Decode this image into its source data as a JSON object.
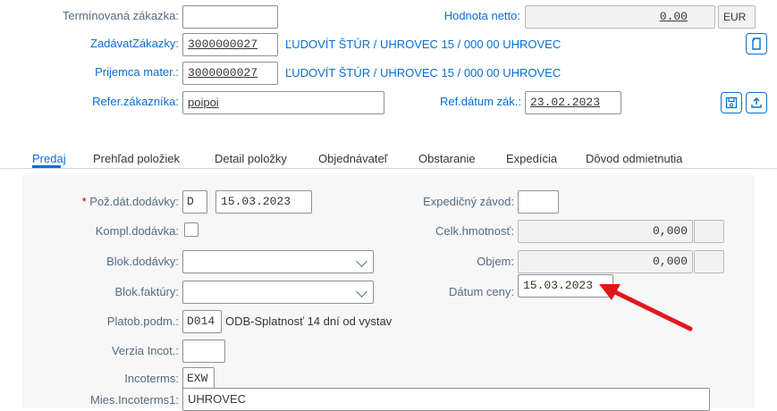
{
  "header": {
    "terminovana_label": "Termínovaná zákazka:",
    "terminovana_value": "",
    "hodnota_label": "Hodnota netto:",
    "hodnota_value": "0.00",
    "hodnota_currency": "EUR",
    "zadavat_label": "ZadávatZákazky:",
    "zadavat_value": "3000000027",
    "zadavat_desc": "ĽUDOVÍT ŠTÚR / UHROVEC 15 / 000 00 UHROVEC",
    "prijemca_label": "Prijemca mater.:",
    "prijemca_value": "3000000027",
    "prijemca_desc": "ĽUDOVÍT ŠTÚR / UHROVEC 15 / 000 00 UHROVEC",
    "refer_label": "Refer.zákazníka:",
    "refer_value": "poipoi",
    "refdatum_label": "Ref.dátum zák.:",
    "refdatum_value": "23.02.2023"
  },
  "tabs": [
    {
      "label": "Predaj",
      "active": true
    },
    {
      "label": "Prehľad položiek"
    },
    {
      "label": "Detail položky"
    },
    {
      "label": "Objednávateľ"
    },
    {
      "label": "Obstaranie"
    },
    {
      "label": "Expedícia"
    },
    {
      "label": "Dôvod odmietnutia"
    }
  ],
  "sales": {
    "poz_datum_label": "Pož.dát.dodávky:",
    "poz_datum_required": "*",
    "poz_datum_type": "D",
    "poz_datum_value": "15.03.2023",
    "kompl_label": "Kompl.dodávka:",
    "kompl_checked": false,
    "blok_dodavky_label": "Blok.dodávky:",
    "blok_dodavky_value": "",
    "blok_faktury_label": "Blok.faktúry:",
    "blok_faktury_value": "",
    "platob_label": "Platob.podm.:",
    "platob_value": "D014",
    "platob_desc": "ODB-Splatnosť 14 dní od vystav",
    "verzia_label": "Verzia Incot.:",
    "verzia_value": "",
    "incoterms_label": "Incoterms:",
    "incoterms_value": "EXW",
    "mies_label": "Mies.Incoterms1:",
    "mies_value": "UHROVEC",
    "expedicny_label": "Expedičný závod:",
    "expedicny_value": "",
    "hmotnost_label": "Celk.hmotnosť:",
    "hmotnost_value": "0,000",
    "hmotnost_unit": "",
    "objem_label": "Objem:",
    "objem_value": "0,000",
    "objem_unit": "",
    "datum_ceny_label": "Dátum ceny:",
    "datum_ceny_value": "15.03.2023"
  },
  "icons": {
    "document": "document-icon",
    "save": "save-icon",
    "export": "export-icon",
    "dropdown": "chevron-down-icon",
    "annotation": "red-arrow-annotation"
  },
  "colors": {
    "link": "#0a6ed1",
    "label": "#556b82",
    "required": "#bb0000",
    "arrow": "#e3161b"
  }
}
